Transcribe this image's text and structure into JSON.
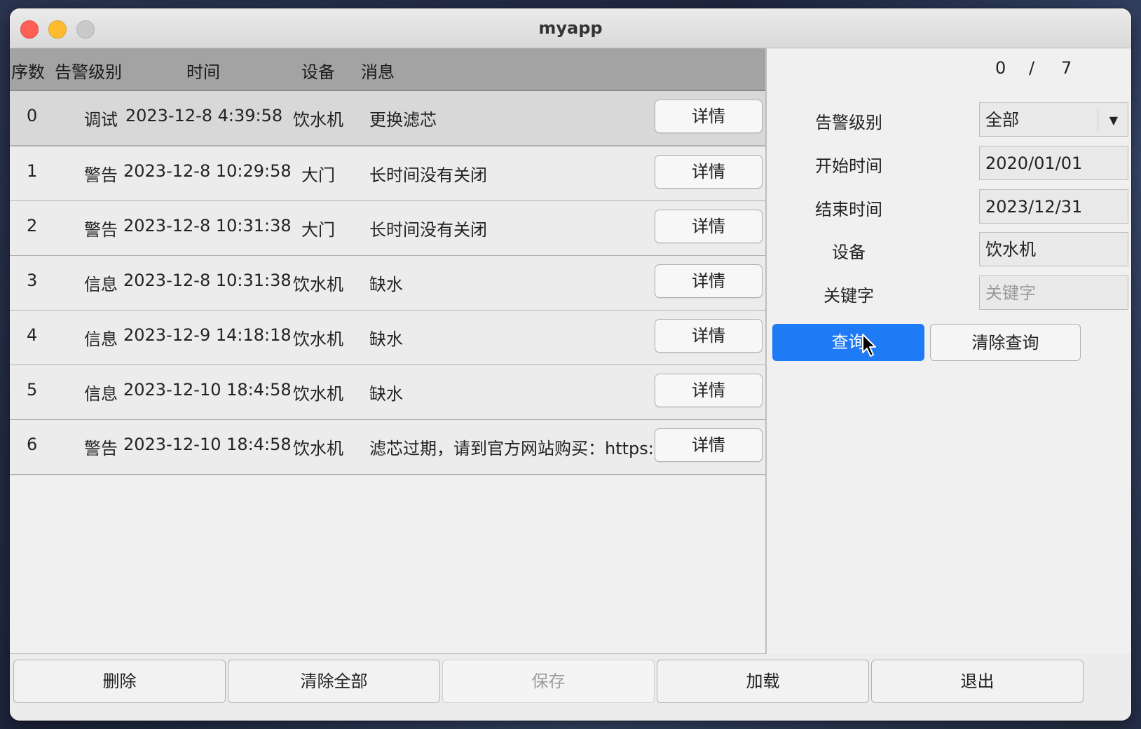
{
  "window": {
    "title": "myapp"
  },
  "table": {
    "headers": [
      "序数",
      "告警级别",
      "时间",
      "设备",
      "消息"
    ],
    "detail_label": "详情",
    "rows": [
      {
        "index": "0",
        "level": "调试",
        "time": "2023-12-8 4:39:58",
        "device": "饮水机",
        "message": "更换滤芯"
      },
      {
        "index": "1",
        "level": "警告",
        "time": "2023-12-8 10:29:58",
        "device": "大门",
        "message": "长时间没有关闭"
      },
      {
        "index": "2",
        "level": "警告",
        "time": "2023-12-8 10:31:38",
        "device": "大门",
        "message": "长时间没有关闭"
      },
      {
        "index": "3",
        "level": "信息",
        "time": "2023-12-8 10:31:38",
        "device": "饮水机",
        "message": "缺水"
      },
      {
        "index": "4",
        "level": "信息",
        "time": "2023-12-9 14:18:18",
        "device": "饮水机",
        "message": "缺水"
      },
      {
        "index": "5",
        "level": "信息",
        "time": "2023-12-10 18:4:58",
        "device": "饮水机",
        "message": "缺水"
      },
      {
        "index": "6",
        "level": "警告",
        "time": "2023-12-10 18:4:58",
        "device": "饮水机",
        "message": "滤芯过期，请到官方网站购买：https://"
      }
    ]
  },
  "filter": {
    "page_current": "0",
    "page_sep": "/",
    "page_total": "7",
    "level_label": "告警级别",
    "level_value": "全部",
    "start_label": "开始时间",
    "start_value": "2020/01/01",
    "end_label": "结束时间",
    "end_value": "2023/12/31",
    "device_label": "设备",
    "device_value": "饮水机",
    "keyword_label": "关键字",
    "keyword_placeholder": "关键字",
    "query_label": "查询",
    "clear_query_label": "清除查询"
  },
  "toolbar": {
    "delete_label": "删除",
    "clear_all_label": "清除全部",
    "save_label": "保存",
    "load_label": "加载",
    "exit_label": "退出"
  },
  "colors": {
    "accent": "#1f7af5",
    "header_bg": "#a3a3a3",
    "selected_row": "#d8d8d8"
  },
  "icons": {
    "dropdown": "chevron-down-icon",
    "cursor": "mouse-pointer-icon"
  }
}
